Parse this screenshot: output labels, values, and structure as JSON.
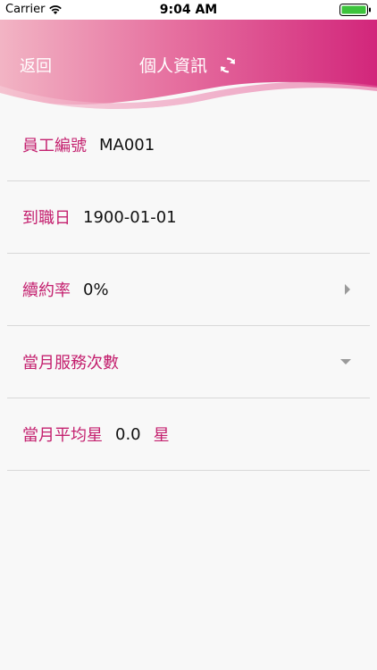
{
  "status_bar": {
    "carrier": "Carrier",
    "time": "9:04 AM"
  },
  "nav": {
    "back_label": "返回",
    "title": "個人資訊",
    "refresh_icon": "refresh-icon"
  },
  "colors": {
    "accent": "#c4216f",
    "header_gradient_start": "#f0a7b9",
    "header_gradient_end": "#d52a7e"
  },
  "rows": [
    {
      "label": "員工編號",
      "value": "MA001",
      "suffix": "",
      "control": "none"
    },
    {
      "label": "到職日",
      "value": "1900-01-01",
      "suffix": "",
      "control": "none"
    },
    {
      "label": "續約率",
      "value": "0%",
      "suffix": "",
      "control": "chevron-right-icon"
    },
    {
      "label": "當月服務次數",
      "value": "",
      "suffix": "",
      "control": "chevron-down-icon"
    },
    {
      "label": "當月平均星",
      "value": "0.0",
      "suffix": "星",
      "control": "none"
    }
  ]
}
